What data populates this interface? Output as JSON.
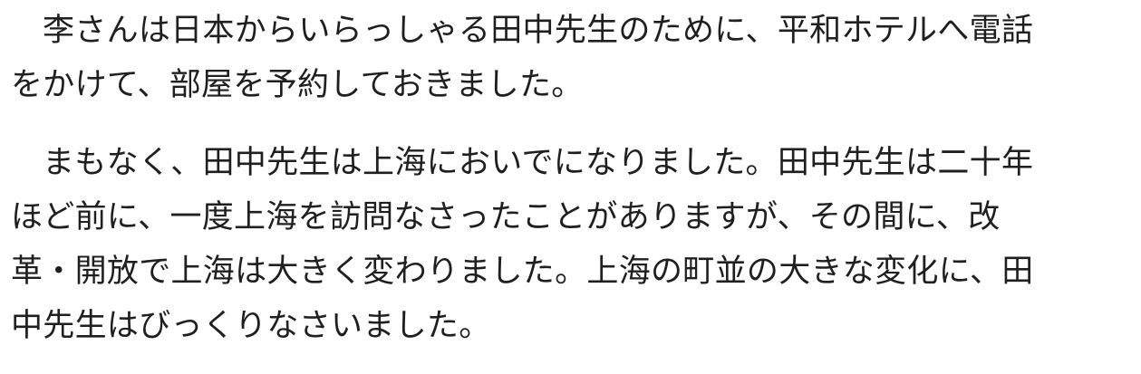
{
  "paragraphs": [
    {
      "lines": [
        "李さんは日本からいらっしゃる田中先生のために、平和ホテルへ電話",
        "をかけて、部屋を予約しておきました。"
      ]
    },
    {
      "lines": [
        "まもなく、田中先生は上海においでになりました。田中先生は二十年",
        "ほど前に、一度上海を訪問なさったことがありますが、その間に、改",
        "革・開放で上海は大きく変わりました。上海の町並の大きな変化に、田",
        "中先生はびっくりなさいました。"
      ]
    }
  ]
}
